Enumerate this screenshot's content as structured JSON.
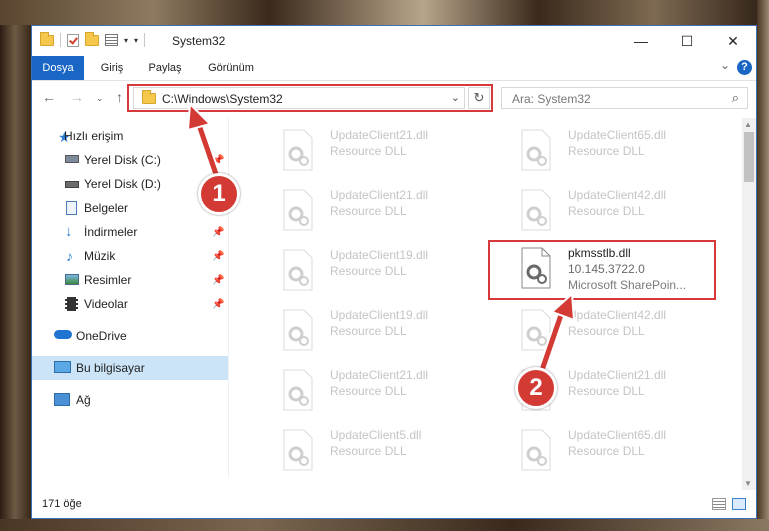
{
  "window": {
    "title": "System32",
    "controls": {
      "minimize": "—",
      "maximize": "☐",
      "close": "✕"
    }
  },
  "ribbon": {
    "tabs": [
      {
        "label": "Dosya",
        "active": true
      },
      {
        "label": "Giriş"
      },
      {
        "label": "Paylaş"
      },
      {
        "label": "Görünüm"
      }
    ],
    "help": "?"
  },
  "navbar": {
    "address": "C:\\Windows\\System32",
    "search_placeholder": "Ara: System32"
  },
  "sidebar": {
    "items": [
      {
        "label": "Hızlı erişim",
        "icon": "star-icon"
      },
      {
        "label": "Yerel Disk (C:)",
        "icon": "drive-icon",
        "pinned": true
      },
      {
        "label": "Yerel Disk (D:)",
        "icon": "drive-icon"
      },
      {
        "label": "Belgeler",
        "icon": "document-icon"
      },
      {
        "label": "İndirmeler",
        "icon": "download-icon",
        "pinned": true
      },
      {
        "label": "Müzik",
        "icon": "music-icon",
        "pinned": true
      },
      {
        "label": "Resimler",
        "icon": "pictures-icon",
        "pinned": true
      },
      {
        "label": "Videolar",
        "icon": "video-icon",
        "pinned": true
      },
      {
        "label": "OneDrive",
        "icon": "cloud-icon"
      },
      {
        "label": "Bu bilgisayar",
        "icon": "computer-icon",
        "selected": true
      },
      {
        "label": "Ağ",
        "icon": "network-icon"
      }
    ]
  },
  "files": [
    {
      "name": "UpdateClient21.dll",
      "type": "Resource DLL"
    },
    {
      "name": "UpdateClient65.dll",
      "type": "Resource DLL"
    },
    {
      "name": "UpdateClient21.dll",
      "type": "Resource DLL"
    },
    {
      "name": "UpdateClient42.dll",
      "type": "Resource DLL"
    },
    {
      "name": "UpdateClient19.dll",
      "type": "Resource DLL"
    },
    {
      "name": "pkmsstlb.dll",
      "type": "10.145.3722.0",
      "desc": "Microsoft SharePoin...",
      "highlighted": true
    },
    {
      "name": "UpdateClient19.dll",
      "type": "Resource DLL"
    },
    {
      "name": "UpdateClient42.dll",
      "type": "Resource DLL"
    },
    {
      "name": "UpdateClient21.dll",
      "type": "Resource DLL"
    },
    {
      "name": "UpdateClient21.dll",
      "type": "Resource DLL"
    },
    {
      "name": "UpdateClient5.dll",
      "type": "Resource DLL"
    },
    {
      "name": "UpdateClient65.dll",
      "type": "Resource DLL"
    }
  ],
  "status": {
    "count": "171 öğe"
  },
  "callouts": [
    {
      "number": "1"
    },
    {
      "number": "2"
    }
  ],
  "colors": {
    "accent": "#1a66c4",
    "highlight": "#d6393b",
    "selected": "#cce4f7"
  }
}
